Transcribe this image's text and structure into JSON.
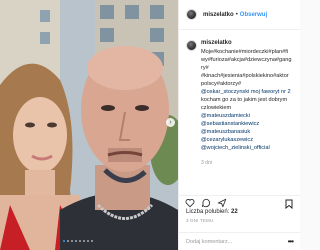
{
  "post": {
    "username": "miszelatko",
    "follow_label": "Obserwuj",
    "separator": "•"
  },
  "caption": {
    "username": "miszelatko",
    "lines": [
      "Moje#kochanie#miordeczki#plan#fi",
      "wy#furioza#akcja#dziewczyna#gang",
      "ry#",
      "#kinach#jesienia#polskiekino#aktor",
      "polscy#aktorzy#",
      "@oskar_stoczynski moj faworyt nr 2",
      "kocham go za to jakim jest dobrym",
      "czlowiekiem",
      "@mateuszdamiecki",
      "@sebastianstankiewicz",
      "@mateuszbanasiuk",
      "@cezarylukaszewicz",
      "@wojciech_zielinski_official"
    ],
    "time": "3 dni"
  },
  "likes": {
    "label": "Liczba polubień:",
    "count": "22"
  },
  "date": "3 DNI TEMU",
  "comment_placeholder": "Dodaj komentarz...",
  "more_menu": "•••",
  "carousel": {
    "arrow": "›",
    "total_slides": 8,
    "active_index": 0
  },
  "colors": {
    "link": "#3897f0",
    "text": "#262626",
    "muted": "#999999"
  },
  "icons": {
    "like": "heart-icon",
    "comment": "comment-icon",
    "share": "share-icon",
    "save": "bookmark-icon"
  }
}
